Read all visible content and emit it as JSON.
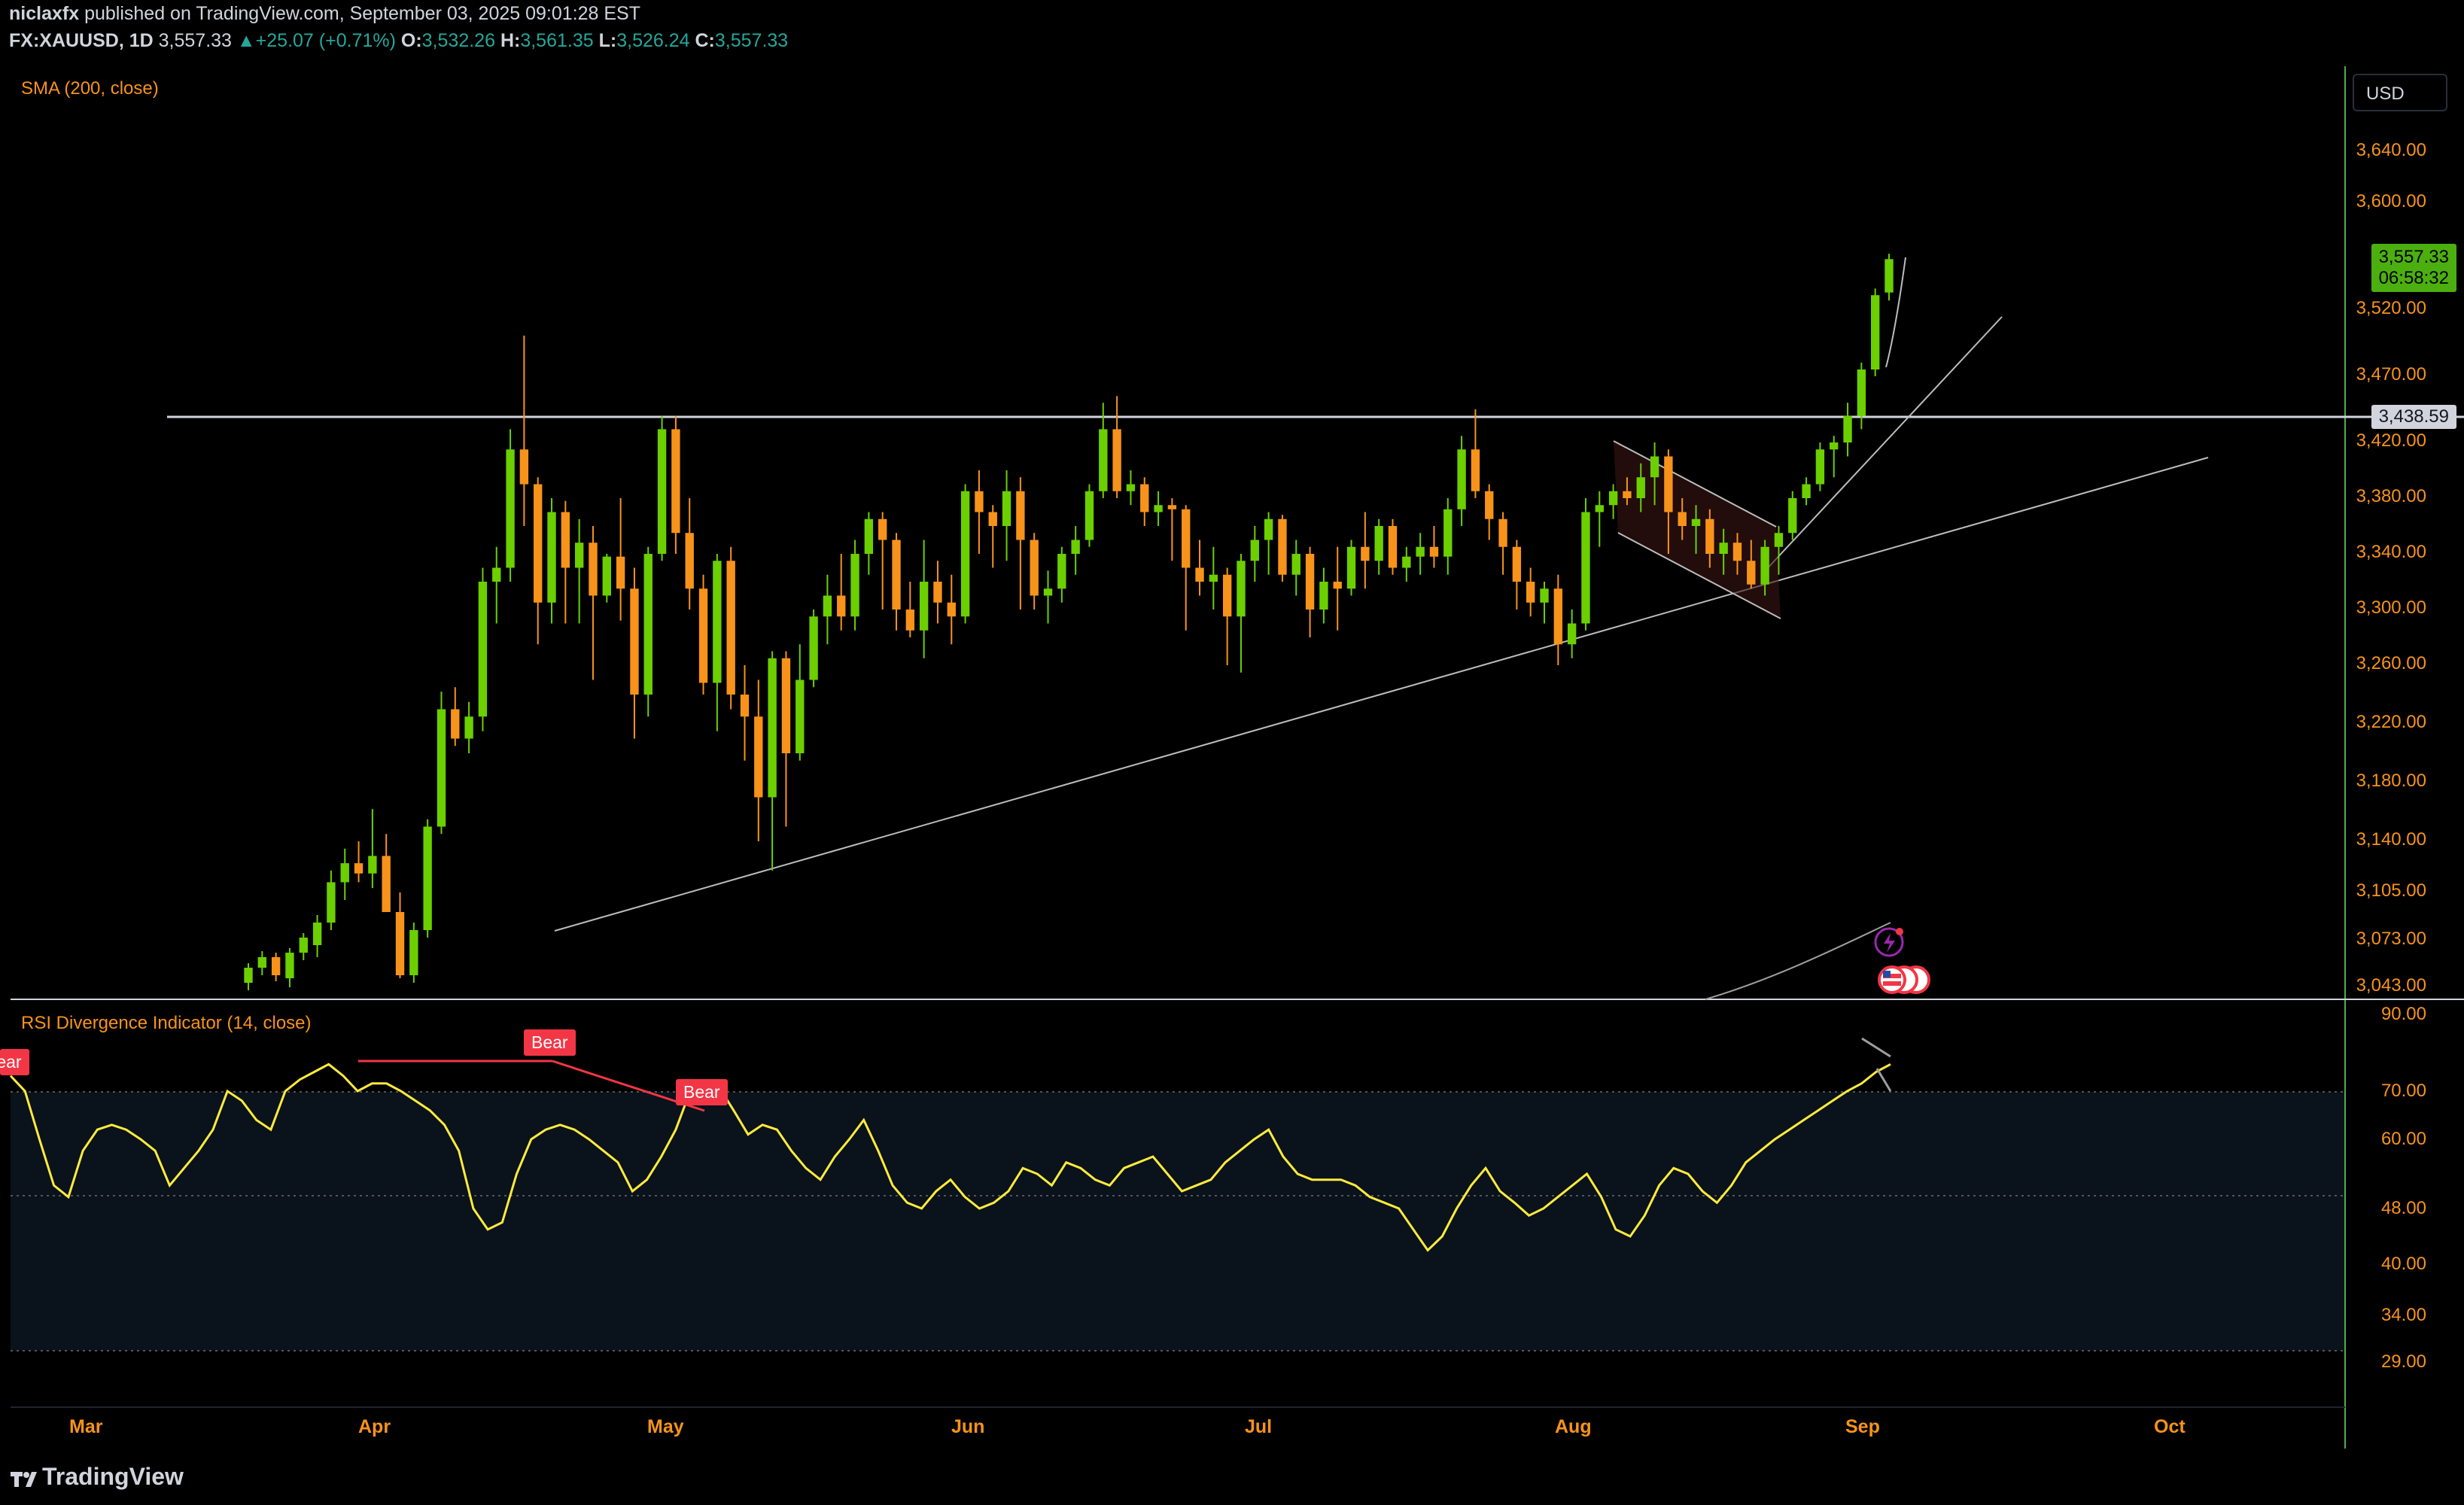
{
  "header": {
    "publisher": "niclaxfx",
    "published_text": "published on TradingView.com, September 03, 2025 09:01:28 EST",
    "symbol": "FX:XAUUSD, 1D",
    "price": "3,557.33",
    "change": "+25.07 (+0.71%)",
    "open_label": "O:",
    "open": "3,532.26",
    "high_label": "H:",
    "high": "3,561.35",
    "low_label": "L:",
    "low": "3,526.24",
    "close_label": "C:",
    "close": "3,557.33"
  },
  "indicators": {
    "sma_label": "SMA (200, close)",
    "rsi_label": "RSI Divergence Indicator (14, close)"
  },
  "currency": "USD",
  "badges": {
    "last_price": "3,557.33",
    "countdown": "06:58:32",
    "level": "3,438.59"
  },
  "footer": {
    "brand": "TradingView"
  },
  "colors": {
    "up": "#6ccf00",
    "down": "#f7931a",
    "rsi": "#ffeb3b",
    "bear": "#f23645",
    "axis": "#f7931a"
  },
  "chart_data": [
    {
      "type": "candlestick",
      "title": "FX:XAUUSD, 1D",
      "y_ticks": [
        3043,
        3073,
        3105,
        3140,
        3180,
        3220,
        3260,
        3300,
        3340,
        3380,
        3420,
        3470,
        3520,
        3600,
        3640
      ],
      "y_tick_labels": [
        "3,043.00",
        "3,073.00",
        "3,105.00",
        "3,140.00",
        "3,180.00",
        "3,220.00",
        "3,260.00",
        "3,300.00",
        "3,340.00",
        "3,380.00",
        "3,420.00",
        "3,470.00",
        "3,520.00",
        "3,600.00",
        "3,640.00"
      ],
      "x_tick_labels": [
        "Mar",
        "Apr",
        "May",
        "Jun",
        "Jul",
        "Aug",
        "Sep",
        "Oct"
      ],
      "horizontal_level": 3438.59,
      "candles": [
        [
          3045,
          3058,
          3040,
          3055
        ],
        [
          3055,
          3066,
          3050,
          3062
        ],
        [
          3062,
          3065,
          3046,
          3050
        ],
        [
          3048,
          3068,
          3042,
          3065
        ],
        [
          3065,
          3078,
          3060,
          3075
        ],
        [
          3070,
          3090,
          3062,
          3085
        ],
        [
          3085,
          3120,
          3080,
          3112
        ],
        [
          3112,
          3135,
          3100,
          3125
        ],
        [
          3125,
          3140,
          3112,
          3118
        ],
        [
          3118,
          3162,
          3108,
          3130
        ],
        [
          3130,
          3145,
          3095,
          3092
        ],
        [
          3092,
          3105,
          3048,
          3050
        ],
        [
          3050,
          3085,
          3045,
          3080
        ],
        [
          3080,
          3155,
          3075,
          3150
        ],
        [
          3150,
          3242,
          3145,
          3230
        ],
        [
          3230,
          3245,
          3205,
          3210
        ],
        [
          3210,
          3235,
          3200,
          3225
        ],
        [
          3225,
          3330,
          3215,
          3320
        ],
        [
          3320,
          3345,
          3290,
          3330
        ],
        [
          3330,
          3430,
          3320,
          3415
        ],
        [
          3415,
          3500,
          3360,
          3390
        ],
        [
          3390,
          3395,
          3275,
          3305
        ],
        [
          3305,
          3380,
          3290,
          3370
        ],
        [
          3370,
          3378,
          3290,
          3330
        ],
        [
          3330,
          3365,
          3290,
          3348
        ],
        [
          3348,
          3360,
          3250,
          3310
        ],
        [
          3310,
          3340,
          3305,
          3338
        ],
        [
          3338,
          3380,
          3292,
          3315
        ],
        [
          3315,
          3330,
          3210,
          3240
        ],
        [
          3240,
          3345,
          3225,
          3340
        ],
        [
          3340,
          3440,
          3335,
          3430
        ],
        [
          3430,
          3440,
          3340,
          3355
        ],
        [
          3355,
          3380,
          3300,
          3315
        ],
        [
          3315,
          3325,
          3240,
          3248
        ],
        [
          3248,
          3340,
          3215,
          3335
        ],
        [
          3335,
          3345,
          3230,
          3240
        ],
        [
          3240,
          3260,
          3195,
          3225
        ],
        [
          3225,
          3250,
          3140,
          3170
        ],
        [
          3170,
          3270,
          3120,
          3265
        ],
        [
          3265,
          3270,
          3150,
          3200
        ],
        [
          3200,
          3275,
          3195,
          3250
        ],
        [
          3250,
          3300,
          3245,
          3295
        ],
        [
          3295,
          3325,
          3275,
          3310
        ],
        [
          3310,
          3340,
          3285,
          3295
        ],
        [
          3295,
          3350,
          3285,
          3340
        ],
        [
          3340,
          3370,
          3325,
          3365
        ],
        [
          3365,
          3370,
          3300,
          3350
        ],
        [
          3350,
          3355,
          3285,
          3300
        ],
        [
          3300,
          3320,
          3280,
          3285
        ],
        [
          3285,
          3350,
          3265,
          3320
        ],
        [
          3320,
          3335,
          3290,
          3305
        ],
        [
          3305,
          3325,
          3275,
          3295
        ],
        [
          3295,
          3390,
          3290,
          3385
        ],
        [
          3385,
          3400,
          3340,
          3370
        ],
        [
          3370,
          3375,
          3330,
          3360
        ],
        [
          3360,
          3400,
          3335,
          3385
        ],
        [
          3385,
          3395,
          3300,
          3350
        ],
        [
          3350,
          3355,
          3300,
          3310
        ],
        [
          3310,
          3328,
          3290,
          3315
        ],
        [
          3315,
          3345,
          3305,
          3340
        ],
        [
          3340,
          3360,
          3325,
          3350
        ],
        [
          3350,
          3390,
          3345,
          3385
        ],
        [
          3385,
          3450,
          3380,
          3430
        ],
        [
          3430,
          3455,
          3380,
          3385
        ],
        [
          3385,
          3400,
          3375,
          3390
        ],
        [
          3390,
          3395,
          3360,
          3370
        ],
        [
          3370,
          3385,
          3360,
          3375
        ],
        [
          3375,
          3380,
          3335,
          3372
        ],
        [
          3372,
          3375,
          3285,
          3330
        ],
        [
          3330,
          3350,
          3310,
          3320
        ],
        [
          3320,
          3345,
          3300,
          3325
        ],
        [
          3325,
          3330,
          3260,
          3295
        ],
        [
          3295,
          3340,
          3255,
          3335
        ],
        [
          3335,
          3360,
          3320,
          3350
        ],
        [
          3350,
          3370,
          3325,
          3365
        ],
        [
          3365,
          3368,
          3320,
          3325
        ],
        [
          3325,
          3350,
          3310,
          3340
        ],
        [
          3340,
          3345,
          3280,
          3300
        ],
        [
          3300,
          3330,
          3290,
          3320
        ],
        [
          3320,
          3345,
          3285,
          3315
        ],
        [
          3315,
          3350,
          3310,
          3345
        ],
        [
          3345,
          3370,
          3315,
          3335
        ],
        [
          3335,
          3365,
          3325,
          3360
        ],
        [
          3360,
          3365,
          3325,
          3330
        ],
        [
          3330,
          3345,
          3320,
          3338
        ],
        [
          3338,
          3355,
          3325,
          3345
        ],
        [
          3345,
          3360,
          3330,
          3338
        ],
        [
          3338,
          3380,
          3325,
          3372
        ],
        [
          3372,
          3425,
          3360,
          3415
        ],
        [
          3415,
          3445,
          3380,
          3385
        ],
        [
          3385,
          3390,
          3350,
          3365
        ],
        [
          3365,
          3370,
          3325,
          3345
        ],
        [
          3345,
          3350,
          3300,
          3320
        ],
        [
          3320,
          3330,
          3295,
          3305
        ],
        [
          3305,
          3320,
          3290,
          3315
        ],
        [
          3315,
          3325,
          3260,
          3275
        ],
        [
          3275,
          3300,
          3265,
          3290
        ],
        [
          3290,
          3380,
          3285,
          3370
        ],
        [
          3370,
          3385,
          3345,
          3375
        ],
        [
          3375,
          3390,
          3365,
          3385
        ],
        [
          3385,
          3395,
          3375,
          3380
        ],
        [
          3380,
          3405,
          3370,
          3395
        ],
        [
          3395,
          3420,
          3375,
          3410
        ],
        [
          3410,
          3415,
          3340,
          3370
        ],
        [
          3370,
          3380,
          3350,
          3360
        ],
        [
          3360,
          3375,
          3340,
          3365
        ],
        [
          3365,
          3372,
          3330,
          3340
        ],
        [
          3340,
          3358,
          3325,
          3348
        ],
        [
          3348,
          3355,
          3325,
          3335
        ],
        [
          3335,
          3350,
          3315,
          3318
        ],
        [
          3318,
          3350,
          3310,
          3345
        ],
        [
          3345,
          3360,
          3325,
          3355
        ],
        [
          3355,
          3385,
          3350,
          3380
        ],
        [
          3380,
          3395,
          3375,
          3390
        ],
        [
          3390,
          3420,
          3385,
          3415
        ],
        [
          3415,
          3425,
          3395,
          3420
        ],
        [
          3420,
          3450,
          3410,
          3440
        ],
        [
          3440,
          3480,
          3430,
          3475
        ],
        [
          3475,
          3535,
          3470,
          3530
        ],
        [
          3532,
          3561,
          3526,
          3557
        ]
      ]
    },
    {
      "type": "line",
      "title": "RSI Divergence Indicator (14, close)",
      "y_ticks": [
        29,
        34,
        40,
        48,
        60,
        70,
        90
      ],
      "y_tick_labels": [
        "29.00",
        "34.00",
        "40.00",
        "48.00",
        "60.00",
        "70.00",
        "90.00"
      ],
      "bands": [
        30,
        50,
        70
      ],
      "annotations": [
        "Bear",
        "Bear",
        "Bear"
      ],
      "values": [
        74,
        70,
        60,
        52,
        50,
        58,
        62,
        63,
        62,
        60,
        58,
        52,
        55,
        58,
        62,
        70,
        68,
        64,
        62,
        70,
        73,
        75,
        77,
        74,
        70,
        72,
        72,
        70,
        68,
        66,
        63,
        58,
        48,
        45,
        46,
        54,
        60,
        62,
        63,
        62,
        60,
        58,
        56,
        51,
        53,
        57,
        62,
        70,
        72,
        71,
        66,
        61,
        63,
        62,
        58,
        55,
        53,
        57,
        60,
        64,
        58,
        52,
        49,
        48,
        51,
        53,
        50,
        48,
        49,
        51,
        55,
        54,
        52,
        56,
        55,
        53,
        52,
        55,
        56,
        57,
        54,
        51,
        52,
        53,
        56,
        58,
        60,
        62,
        57,
        54,
        53,
        53,
        53,
        52,
        50,
        49,
        48,
        45,
        42,
        44,
        48,
        52,
        55,
        51,
        49,
        47,
        48,
        50,
        52,
        54,
        50,
        45,
        44,
        47,
        52,
        55,
        54,
        51,
        49,
        52,
        56,
        58,
        60,
        62,
        64,
        66,
        68,
        70,
        72,
        75,
        77
      ]
    }
  ]
}
